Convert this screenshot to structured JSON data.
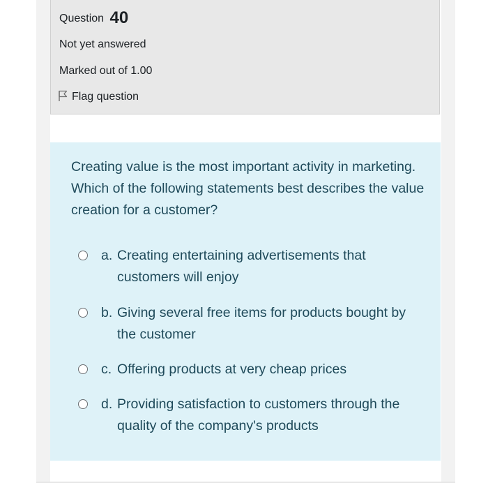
{
  "info": {
    "question_label": "Question",
    "question_number": "40",
    "state": "Not yet answered",
    "grade": "Marked out of 1.00",
    "flag_label": "Flag question"
  },
  "question": {
    "text": "Creating value is the most important activity in marketing. Which of the following statements best describes the value creation for a customer?"
  },
  "answers": [
    {
      "letter": "a.",
      "text": "Creating entertaining advertisements that customers will enjoy"
    },
    {
      "letter": "b.",
      "text": "Giving several free items for products bought by the customer"
    },
    {
      "letter": "c.",
      "text": "Offering products at very cheap prices"
    },
    {
      "letter": "d.",
      "text": "Providing satisfaction to customers through the quality of the company's products"
    }
  ],
  "colors": {
    "info_bg": "#e8e8e8",
    "content_bg": "#def2f8",
    "question_text": "#1f4a5a"
  },
  "icons": {
    "flag": "flag-icon",
    "radio": "radio-unselected"
  }
}
